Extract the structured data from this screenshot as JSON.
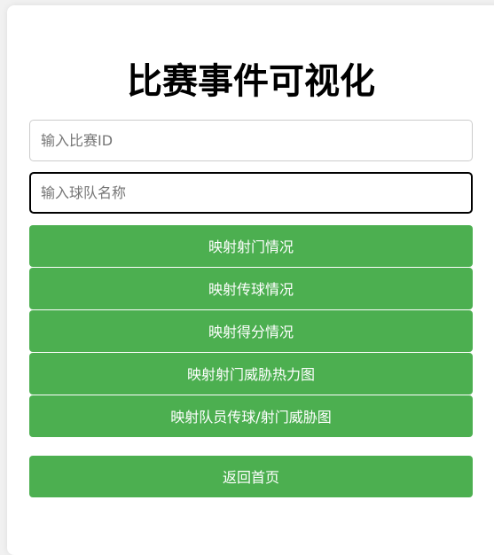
{
  "page": {
    "title": "比赛事件可视化"
  },
  "inputs": {
    "match_id_placeholder": "输入比赛ID",
    "match_id_value": "",
    "team_name_placeholder": "输入球队名称",
    "team_name_value": ""
  },
  "buttons": {
    "shots": "映射射门情况",
    "passes": "映射传球情况",
    "goals": "映射得分情况",
    "shot_threat_heatmap": "映射射门威胁热力图",
    "player_pass_shot_threat": "映射队员传球/射门威胁图",
    "back_home": "返回首页"
  },
  "colors": {
    "accent": "#4caf50",
    "title": "#000000",
    "card_background": "#ffffff",
    "page_background": "#f1f1f1"
  }
}
